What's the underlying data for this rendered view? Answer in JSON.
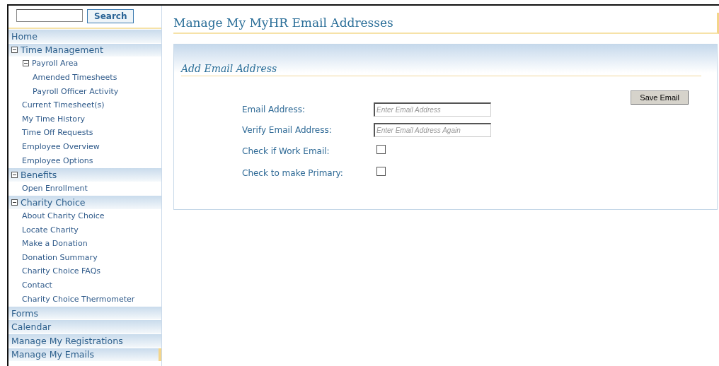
{
  "search": {
    "button": "Search"
  },
  "nav": [
    {
      "label": "Home",
      "selected": false
    },
    {
      "label": "Time Management",
      "expanded": true,
      "selected": false,
      "children": [
        {
          "label": "Payroll Area",
          "expanded": true,
          "selected": false,
          "children": [
            {
              "label": "Amended Timesheets",
              "selected": false
            },
            {
              "label": "Payroll Officer Activity",
              "selected": false
            }
          ]
        },
        {
          "label": "Current Timesheet(s)",
          "selected": false
        },
        {
          "label": "My Time History",
          "selected": false
        },
        {
          "label": "Time Off Requests",
          "selected": false
        },
        {
          "label": "Employee Overview",
          "selected": false
        },
        {
          "label": "Employee Options",
          "selected": false
        }
      ]
    },
    {
      "label": "Benefits",
      "expanded": true,
      "selected": false,
      "children": [
        {
          "label": "Open Enrollment",
          "selected": false
        }
      ]
    },
    {
      "label": "Charity Choice",
      "expanded": true,
      "selected": false,
      "children": [
        {
          "label": "About Charity Choice",
          "selected": false
        },
        {
          "label": "Locate Charity",
          "selected": false
        },
        {
          "label": "Make a Donation",
          "selected": false
        },
        {
          "label": "Donation Summary",
          "selected": false
        },
        {
          "label": "Charity Choice FAQs",
          "selected": false
        },
        {
          "label": "Contact",
          "selected": false
        },
        {
          "label": "Charity Choice Thermometer",
          "selected": false
        }
      ]
    },
    {
      "label": "Forms",
      "selected": false
    },
    {
      "label": "Calendar",
      "selected": false
    },
    {
      "label": "Manage My Registrations",
      "selected": false
    },
    {
      "label": "Manage My Emails",
      "selected": true
    }
  ],
  "page_title": "Manage My MyHR Email Addresses",
  "panel": {
    "title": "Add Email Address",
    "save_button": "Save Email",
    "rows": [
      {
        "label": "Email Address:",
        "kind": "text",
        "placeholder": "Enter Email Address"
      },
      {
        "label": "Verify Email Address:",
        "kind": "text",
        "placeholder": "Enter Email Address Again"
      },
      {
        "label": "Check if Work Email:",
        "kind": "checkbox",
        "checked": false
      },
      {
        "label": "Check to make Primary:",
        "kind": "checkbox",
        "checked": false
      }
    ]
  }
}
